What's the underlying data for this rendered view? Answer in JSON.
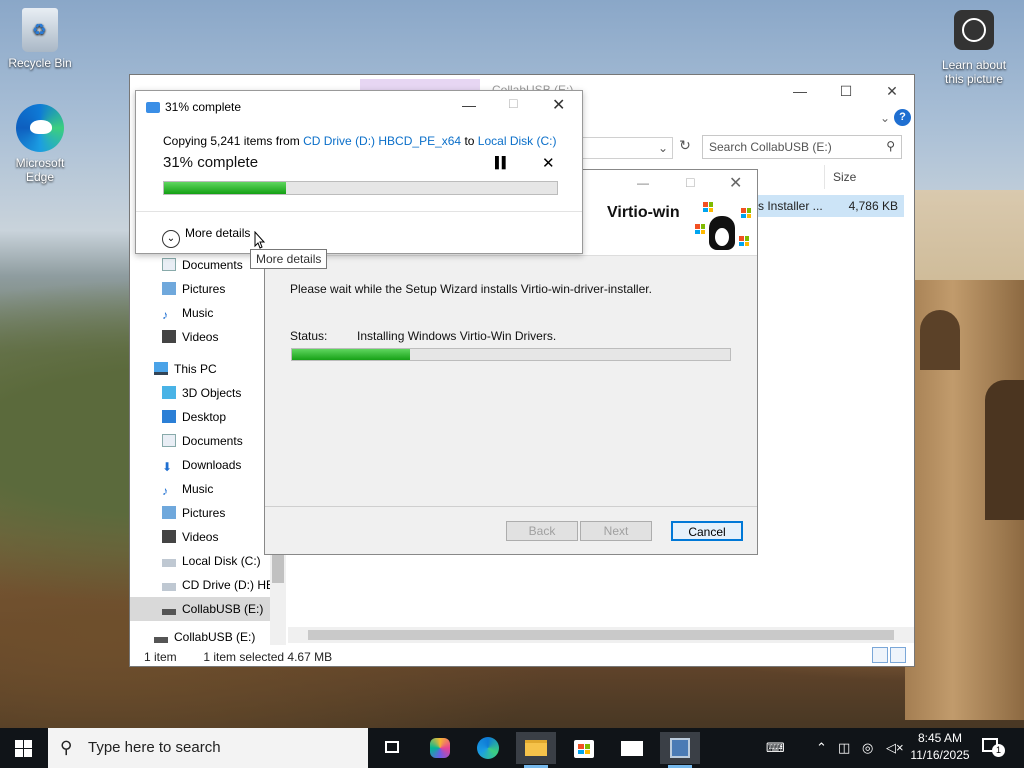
{
  "desktop": {
    "recycle_bin": "Recycle Bin",
    "edge": "Microsoft Edge",
    "learn": "Learn about this picture"
  },
  "explorer": {
    "title": "CollabUSB (E:)",
    "search_placeholder": "Search CollabUSB (E:)",
    "column_size": "Size",
    "selected_row": {
      "name": "s Installer ...",
      "size": "4,786 KB"
    },
    "nav_items": [
      {
        "label": "Documents",
        "icon": "documents-icon"
      },
      {
        "label": "Pictures",
        "icon": "pictures-icon"
      },
      {
        "label": "Music",
        "icon": "music-icon"
      },
      {
        "label": "Videos",
        "icon": "videos-icon"
      },
      {
        "label": "This PC",
        "icon": "computer-icon"
      },
      {
        "label": "3D Objects",
        "icon": "3d-objects-icon"
      },
      {
        "label": "Desktop",
        "icon": "desktop-icon"
      },
      {
        "label": "Documents",
        "icon": "documents-icon"
      },
      {
        "label": "Downloads",
        "icon": "downloads-icon"
      },
      {
        "label": "Music",
        "icon": "music-icon"
      },
      {
        "label": "Pictures",
        "icon": "pictures-icon"
      },
      {
        "label": "Videos",
        "icon": "videos-icon"
      },
      {
        "label": "Local Disk (C:)",
        "icon": "drive-icon"
      },
      {
        "label": "CD Drive (D:) HB",
        "icon": "cd-drive-icon"
      },
      {
        "label": "CollabUSB (E:)",
        "icon": "usb-drive-icon"
      },
      {
        "label": "CollabUSB (E:)",
        "icon": "usb-drive-icon"
      }
    ],
    "status_items": "1 item",
    "status_selected": "1 item selected  4.67 MB"
  },
  "wizard": {
    "brand": "Virtio-win",
    "message": "Please wait while the Setup Wizard installs Virtio-win-driver-installer.",
    "status_label": "Status:",
    "status_value": "Installing Windows Virtio-Win Drivers.",
    "progress": 0.27,
    "back": "Back",
    "next": "Next",
    "cancel": "Cancel"
  },
  "copy": {
    "title": "31% complete",
    "line_prefix": "Copying 5,241 items from ",
    "source": "CD Drive (D:) HBCD_PE_x64",
    "to": " to ",
    "dest": "Local Disk (C:)",
    "percent_text": "31% complete",
    "progress": 0.31,
    "more_details": "More details",
    "tooltip": "More details"
  },
  "taskbar": {
    "search_placeholder": "Type here to search",
    "time": "8:45 AM",
    "date": "11/16/2025",
    "notification_count": "1"
  },
  "colors": {
    "accent": "#0078d7",
    "progress": "#16a116",
    "link": "#0b6fc9"
  }
}
